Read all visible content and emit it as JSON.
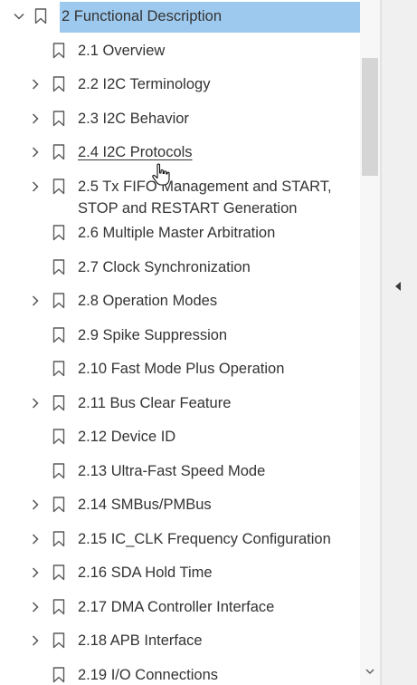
{
  "bookmarks": {
    "items": [
      {
        "label": "2 Functional Description",
        "chevron": "expanded",
        "selected": true
      },
      {
        "label": "2.1 Overview",
        "chevron": "none"
      },
      {
        "label": "2.2 I2C Terminology",
        "chevron": "collapsed"
      },
      {
        "label": "2.3 I2C Behavior",
        "chevron": "collapsed"
      },
      {
        "label": "2.4 I2C Protocols",
        "chevron": "collapsed",
        "hovered": true
      },
      {
        "label": "2.5 Tx FIFO Management and START,\nSTOP and RESTART Generation",
        "chevron": "collapsed"
      },
      {
        "label": "2.6 Multiple Master Arbitration",
        "chevron": "none"
      },
      {
        "label": "2.7 Clock Synchronization",
        "chevron": "none"
      },
      {
        "label": "2.8 Operation Modes",
        "chevron": "collapsed"
      },
      {
        "label": "2.9 Spike Suppression",
        "chevron": "none"
      },
      {
        "label": "2.10 Fast Mode Plus Operation",
        "chevron": "none"
      },
      {
        "label": "2.11 Bus Clear Feature",
        "chevron": "collapsed"
      },
      {
        "label": "2.12 Device ID",
        "chevron": "none"
      },
      {
        "label": "2.13 Ultra-Fast Speed Mode",
        "chevron": "none"
      },
      {
        "label": "2.14 SMBus/PMBus",
        "chevron": "collapsed"
      },
      {
        "label": "2.15 IC_CLK Frequency Configuration",
        "chevron": "collapsed"
      },
      {
        "label": "2.16 SDA Hold Time",
        "chevron": "collapsed"
      },
      {
        "label": "2.17 DMA Controller Interface",
        "chevron": "collapsed"
      },
      {
        "label": "2.18 APB Interface",
        "chevron": "collapsed"
      },
      {
        "label": "2.19 I/O Connections",
        "chevron": "none"
      }
    ]
  },
  "colors": {
    "selection": "#9ec9ee",
    "text": "#333333",
    "icon": "#5a5a5a",
    "scroll_thumb": "#d5d5d5",
    "panel_strip": "#f0f0f0"
  },
  "icons": {
    "expanded": "chevron-down-icon",
    "collapsed": "chevron-right-icon",
    "bookmark": "bookmark-icon",
    "collapse_panel": "triangle-left-icon",
    "scroll_down": "chevron-down-icon",
    "cursor": "hand-pointer-icon"
  }
}
